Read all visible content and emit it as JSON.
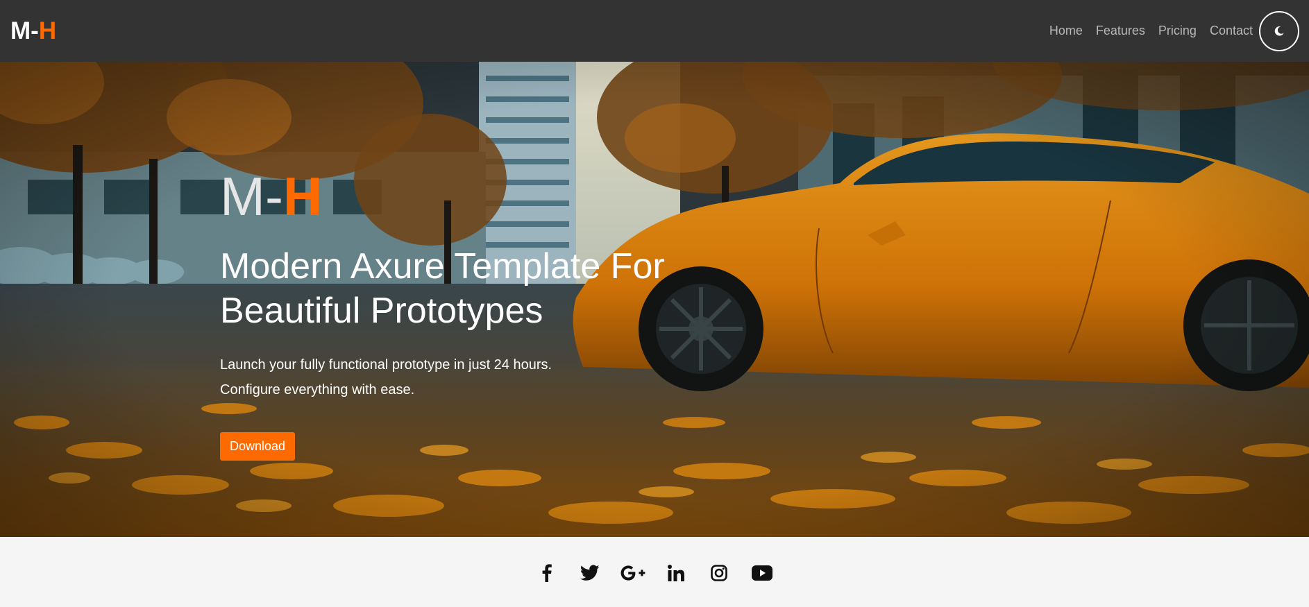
{
  "brand": {
    "part1": "M-",
    "part2": "H"
  },
  "nav": {
    "items": [
      {
        "label": "Home"
      },
      {
        "label": "Features"
      },
      {
        "label": "Pricing"
      },
      {
        "label": "Contact"
      }
    ],
    "theme_toggle_icon": "moon-icon"
  },
  "hero": {
    "logo_part1": "M-",
    "logo_part2": "H",
    "title": "Modern Axure Template For Beautiful Prototypes",
    "subtitle_line1": "Launch your fully functional prototype in just 24 hours.",
    "subtitle_line2": "Configure everything with ease.",
    "download_label": "Download",
    "background": "orange sports car on autumn leaf covered street"
  },
  "footer": {
    "social": [
      "facebook-icon",
      "twitter-icon",
      "google-plus-icon",
      "linkedin-icon",
      "instagram-icon",
      "youtube-icon"
    ]
  },
  "colors": {
    "accent": "#ff6a00",
    "navbar": "#333333",
    "footer": "#f5f5f5"
  }
}
